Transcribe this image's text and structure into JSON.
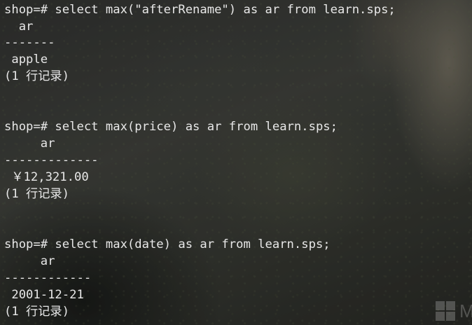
{
  "terminal": {
    "lines": [
      "shop=# select max(\"afterRename\") as ar from learn.sps;",
      "  ar",
      "-------",
      " apple",
      "(1 行记录)",
      "",
      "",
      "shop=# select max(price) as ar from learn.sps;",
      "     ar",
      "-------------",
      " ￥12,321.00",
      "(1 行记录)",
      "",
      "",
      "shop=# select max(date) as ar from learn.sps;",
      "     ar",
      "------------",
      " 2001-12-21",
      "(1 行记录)"
    ]
  },
  "watermark": {
    "text": "M",
    "icon": "windows-logo-icon"
  },
  "colors": {
    "text": "#e8e8e8",
    "background": "#3a3b38"
  }
}
